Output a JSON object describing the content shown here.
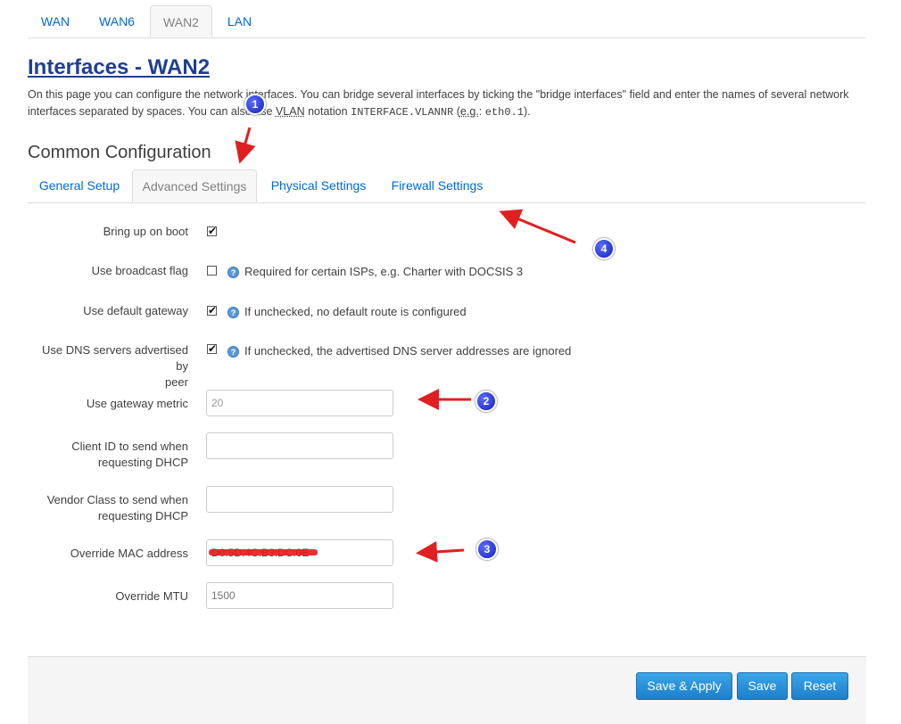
{
  "top_tabs": [
    "WAN",
    "WAN6",
    "WAN2",
    "LAN"
  ],
  "title": "Interfaces - WAN2",
  "description": {
    "part1": "On this page you can configure the network interfaces. You can bridge several interfaces by ticking the \"bridge interfaces\" field and enter the names of several network interfaces separated by spaces. You can also use ",
    "vlan": "VLAN",
    "part2": " notation ",
    "code": "INTERFACE.VLANNR",
    "part3": " (",
    "eg": "e.g.",
    "part4": ": ",
    "example": "eth0.1",
    "part5": ")."
  },
  "section_title": "Common Configuration",
  "sub_tabs": [
    "General Setup",
    "Advanced Settings",
    "Physical Settings",
    "Firewall Settings"
  ],
  "fields": {
    "bring_up": {
      "label": "Bring up on boot",
      "checked": true
    },
    "broadcast": {
      "label": "Use broadcast flag",
      "checked": false,
      "hint": "Required for certain ISPs, e.g. Charter with DOCSIS 3"
    },
    "default_gw": {
      "label": "Use default gateway",
      "checked": true,
      "hint": "If unchecked, no default route is configured"
    },
    "peer_dns": {
      "label_line1": "Use DNS servers advertised by",
      "label_line2": "peer",
      "checked": true,
      "hint": "If unchecked, the advertised DNS server addresses are ignored"
    },
    "metric": {
      "label": "Use gateway metric",
      "value": "20"
    },
    "client_id": {
      "label_line1": "Client ID to send when",
      "label_line2": "requesting DHCP",
      "value": ""
    },
    "vendor_class": {
      "label_line1": "Vendor Class to send when",
      "label_line2": "requesting DHCP",
      "value": ""
    },
    "mac": {
      "label": "Override MAC address",
      "value": "D0:5D:4C:B3:DC:0E"
    },
    "mtu": {
      "label": "Override MTU",
      "placeholder": "1500"
    }
  },
  "buttons": {
    "save_apply": "Save & Apply",
    "save": "Save",
    "reset": "Reset"
  },
  "markers": [
    "1",
    "2",
    "3",
    "4"
  ],
  "colors": {
    "link": "#0069d6",
    "title": "#1f3f8f",
    "button": "#1c7fcb",
    "arrow": "#e02020",
    "marker": "#1420b8"
  }
}
